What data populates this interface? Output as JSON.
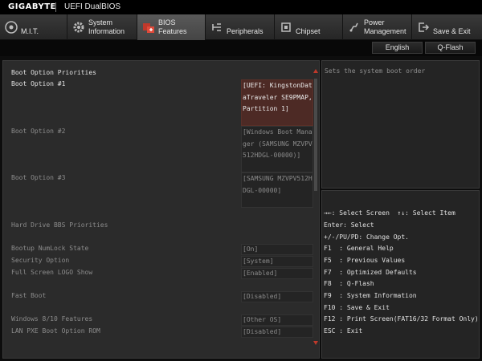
{
  "header": {
    "brand": "GIGABYTE",
    "title": "UEFI DualBIOS"
  },
  "tabs": [
    {
      "line1": "",
      "line2": "M.I.T.",
      "icon": "mit-disc-icon"
    },
    {
      "line1": "System",
      "line2": "Information",
      "icon": "gear-icon"
    },
    {
      "line1": "BIOS",
      "line2": "Features",
      "icon": "bios-features-icon"
    },
    {
      "line1": "",
      "line2": "Peripherals",
      "icon": "peripherals-icon"
    },
    {
      "line1": "",
      "line2": "Chipset",
      "icon": "chipset-icon"
    },
    {
      "line1": "Power",
      "line2": "Management",
      "icon": "power-icon"
    },
    {
      "line1": "",
      "line2": "Save & Exit",
      "icon": "exit-door-icon"
    }
  ],
  "toolbar": {
    "language": "English",
    "qflash": "Q-Flash"
  },
  "section": {
    "title": "Boot Option Priorities"
  },
  "settings": {
    "boot1": {
      "label": "Boot Option #1",
      "value": "[UEFI: KingstonDataTraveler SE9PMAP, Partition 1]"
    },
    "boot2": {
      "label": "Boot Option #2",
      "value": "[Windows Boot Manager (SAMSUNG MZVPV512HDGL-00000)]"
    },
    "boot3": {
      "label": "Boot Option #3",
      "value": "[SAMSUNG MZVPV512HDGL-00000]"
    },
    "hdd_bbs": {
      "label": "Hard Drive BBS Priorities"
    },
    "numlock": {
      "label": "Bootup NumLock State",
      "value": "[On]"
    },
    "security": {
      "label": "Security Option",
      "value": "[System]"
    },
    "logo": {
      "label": "Full Screen LOGO Show",
      "value": "[Enabled]"
    },
    "fastboot": {
      "label": "Fast Boot",
      "value": "[Disabled]"
    },
    "win8": {
      "label": "Windows 8/10 Features",
      "value": "[Other OS]"
    },
    "pxe": {
      "label": "LAN PXE Boot Option ROM",
      "value": "[Disabled]"
    }
  },
  "help": {
    "text": "Sets the system boot order"
  },
  "keys": [
    "→←: Select Screen  ↑↓: Select Item",
    "Enter: Select",
    "+/-/PU/PD: Change Opt.",
    "F1  : General Help",
    "F5  : Previous Values",
    "F7  : Optimized Defaults",
    "F8  : Q-Flash",
    "F9  : System Information",
    "F10 : Save & Exit",
    "F12 : Print Screen(FAT16/32 Format Only)",
    "ESC : Exit"
  ],
  "colors": {
    "accent": "#c0392b",
    "selected_bg": "#4d2a25"
  }
}
